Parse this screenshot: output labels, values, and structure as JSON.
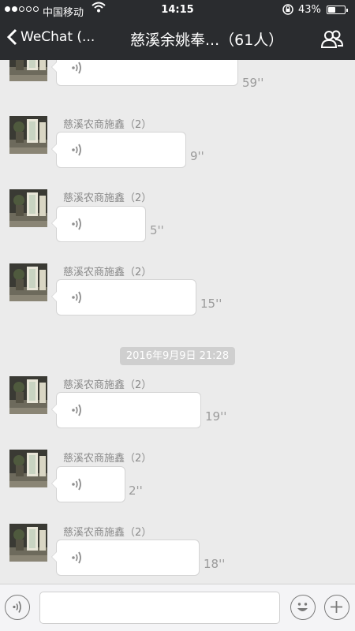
{
  "status_bar": {
    "carrier": "中国移动",
    "time": "14:15",
    "battery_percent": "43%",
    "battery_level": 0.43
  },
  "nav": {
    "back_label": "WeChat (...",
    "title": "慈溪余姚奉...（61人）"
  },
  "timestamp_divider": "2016年9月9日 21:28",
  "messages": [
    {
      "sender": "",
      "duration": "59''"
    },
    {
      "sender": "慈溪农商施鑫（2）",
      "duration": "9''"
    },
    {
      "sender": "慈溪农商施鑫（2）",
      "duration": "5''"
    },
    {
      "sender": "慈溪农商施鑫（2）",
      "duration": "15''"
    },
    {
      "sender": "慈溪农商施鑫（2）",
      "duration": "19''"
    },
    {
      "sender": "慈溪农商施鑫（2）",
      "duration": "2''"
    },
    {
      "sender": "慈溪农商施鑫（2）",
      "duration": "18''"
    }
  ],
  "colors": {
    "nav_background": "#2a2c2f",
    "chat_background": "#ebebeb",
    "bubble": "#ffffff"
  },
  "icons": {
    "back": "chevron-left-icon",
    "group": "group-members-icon",
    "voice": "voice-wave-icon",
    "voice_mode": "voice-input-icon",
    "emoji": "emoji-icon",
    "more": "plus-icon"
  }
}
